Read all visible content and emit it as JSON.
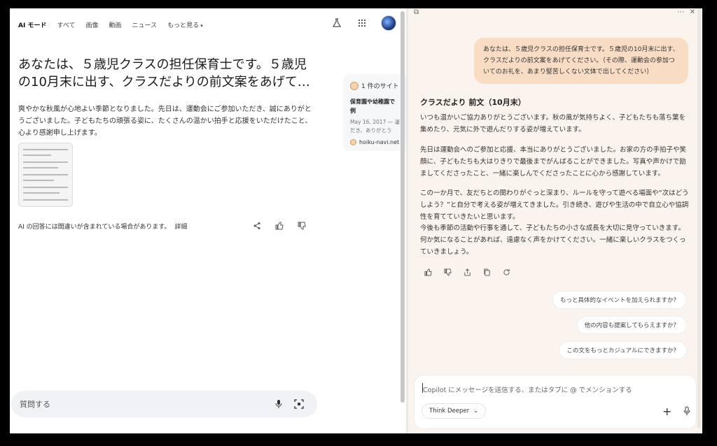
{
  "left": {
    "nav": [
      "AI モード",
      "すべて",
      "画像",
      "動画",
      "ニュース",
      "もっと見る"
    ],
    "query": "あなたは、５歳児クラスの担任保育士です。５歳児の10月末に出す、クラスだよりの前文案をあげて…",
    "answer": "爽やかな秋風が心地よい季節となりました。先日は、運動会にご参加いただき、誠にありがとうございました。子どもたちの頑張る姿に、たくさんの温かい拍手と応援をいただけたこと、心より感謝申し上げます。",
    "disclaimer": "AI の回答には間違いが含まれている場合があります。",
    "detail_link": "詳細",
    "source": {
      "count": "1 件のサイト",
      "title": "保育園や幼稚園で",
      "title2": "例",
      "date": "May 16, 2017 — 運",
      "snippet": "だき、ありがとう",
      "site": "hoiku-navi.net"
    },
    "ask_placeholder": "質問する"
  },
  "right": {
    "user_message": "あなたは、５歳児クラスの担任保育士です。５歳児の10月末に出す、クラスだよりの前文案をあげてください。（その際、運動会の参加ついてのお礼を、あまり堅苦しくない文体で出してください）",
    "heading": "クラスだより 前文（10月末）",
    "paragraphs": [
      "いつも温かいご協力ありがとうございます。秋の風が気持ちよく、子どもたちも落ち葉を集めたり、元気に外で遊んだりする姿が増えています。",
      "先日は運動会へのご参加と応援、本当にありがとうございました。お家の方の手拍子や笑顔に、子どもたちも大はりきりで最後までがんばることができました。写真や声かけで励ましてくださったこと、一緒に楽しんでくださったことに心から感謝しています。",
      "この一か月で、友だちとの関わりがぐっと深まり、ルールを守って遊べる場面や“次はどうしよう？”と自分で考える姿が増えてきました。引き続き、遊びや生活の中で自立心や協調性を育てていきたいと思います。",
      "今後も季節の活動や行事を通して、子どもたちの小さな成長を大切に見守っていきます。何か気になることがあれば、遠慮なく声をかけてください。一緒に楽しいクラスをつくっていきましょう。"
    ],
    "suggestions": [
      "もっと具体的なイベントを加えられますか？",
      "他の内容も提案してもらえますか？",
      "この文をもっとカジュアルにできますか？"
    ],
    "composer_placeholder": "Copilot にメッセージを送信する、またはタブに @ でメンションする",
    "mode_label": "Think Deeper"
  }
}
